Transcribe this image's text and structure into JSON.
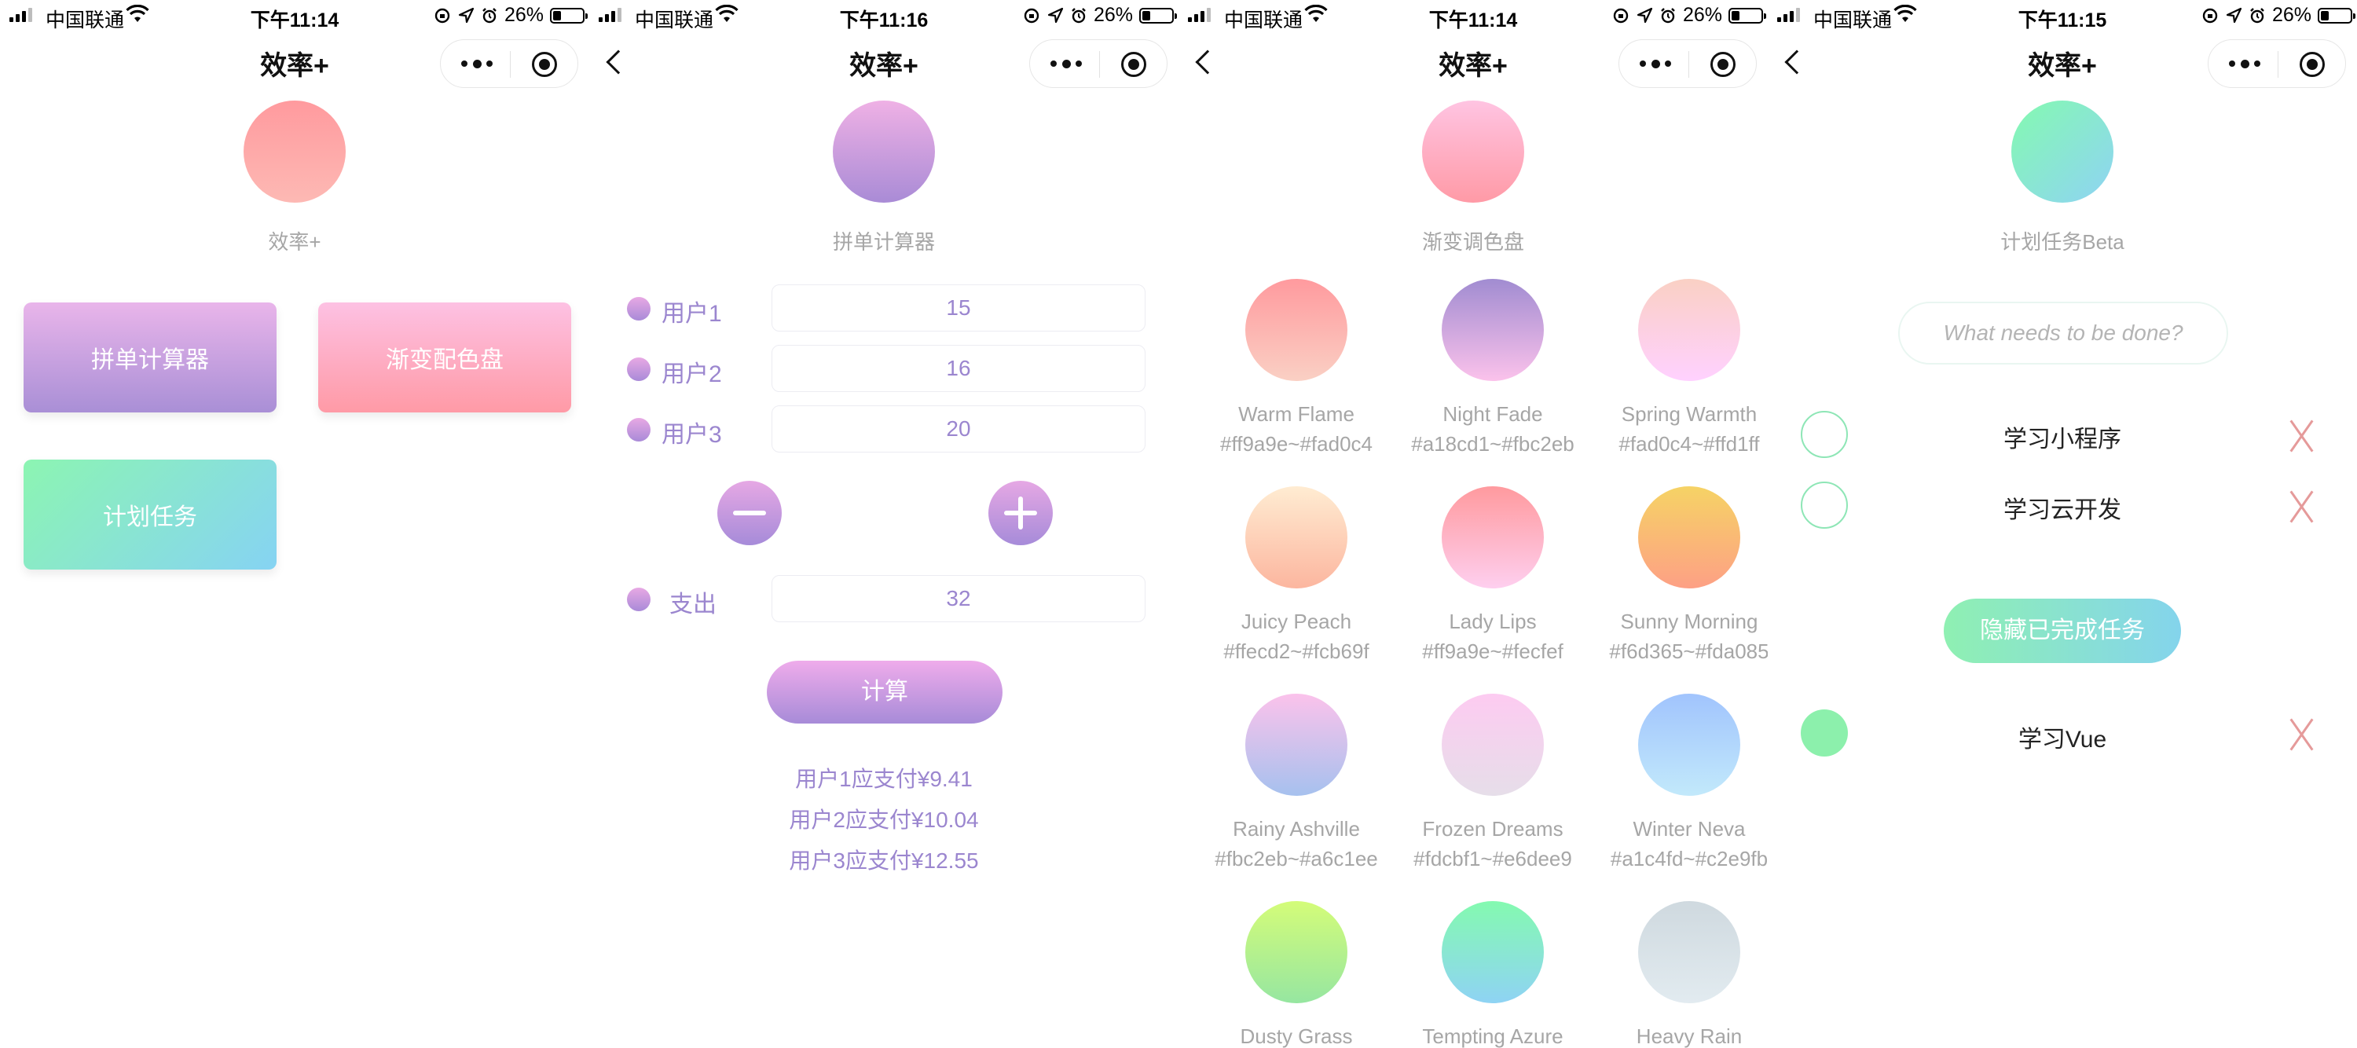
{
  "statusbar": {
    "carrier": "中国联通",
    "battery": "26%",
    "battery_level": 0.26,
    "icons": [
      "signal-icon",
      "wifi-icon",
      "lock-rotation-icon",
      "location-arrow-icon",
      "alarm-icon",
      "battery-icon"
    ]
  },
  "capsule": {
    "icons": [
      "more-dots-icon",
      "close-target-icon"
    ]
  },
  "screens": {
    "home": {
      "time": "下午11:14",
      "title": "效率+",
      "header_label": "效率+",
      "tiles": [
        {
          "label": "拼单计算器",
          "gradient": [
            "#e9b5ea",
            "#a98fd6"
          ]
        },
        {
          "label": "渐变配色盘",
          "gradient": [
            "#fdc1e3",
            "#ff9aa6"
          ]
        },
        {
          "label": "计划任务",
          "gradient": [
            "#8cf5b2",
            "#86d3f3"
          ]
        }
      ]
    },
    "split": {
      "time": "下午11:16",
      "title": "效率+",
      "header_label": "拼单计算器",
      "rows": [
        {
          "label": "用户1",
          "value": "15"
        },
        {
          "label": "用户2",
          "value": "16"
        },
        {
          "label": "用户3",
          "value": "20"
        }
      ],
      "expense": {
        "label": "支出",
        "value": "32"
      },
      "calc_label": "计算",
      "results": [
        "用户1应支付¥9.41",
        "用户2应支付¥10.04",
        "用户3应支付¥12.55"
      ]
    },
    "palette": {
      "time": "下午11:14",
      "title": "效率+",
      "header_label": "渐变调色盘",
      "swatches": [
        {
          "name": "Warm Flame",
          "codes": "#ff9a9e~#fad0c4",
          "from": "#ff9a9e",
          "to": "#fad0c4"
        },
        {
          "name": "Night Fade",
          "codes": "#a18cd1~#fbc2eb",
          "from": "#a18cd1",
          "to": "#fbc2eb"
        },
        {
          "name": "Spring Warmth",
          "codes": "#fad0c4~#ffd1ff",
          "from": "#fad0c4",
          "to": "#ffd1ff"
        },
        {
          "name": "Juicy Peach",
          "codes": "#ffecd2~#fcb69f",
          "from": "#ffecd2",
          "to": "#fcb69f"
        },
        {
          "name": "Lady Lips",
          "codes": "#ff9a9e~#fecfef",
          "from": "#ff9a9e",
          "to": "#fecfef"
        },
        {
          "name": "Sunny Morning",
          "codes": "#f6d365~#fda085",
          "from": "#f6d365",
          "to": "#fda085"
        },
        {
          "name": "Rainy Ashville",
          "codes": "#fbc2eb~#a6c1ee",
          "from": "#fbc2eb",
          "to": "#a6c1ee"
        },
        {
          "name": "Frozen Dreams",
          "codes": "#fdcbf1~#e6dee9",
          "from": "#fdcbf1",
          "to": "#e6dee9"
        },
        {
          "name": "Winter Neva",
          "codes": "#a1c4fd~#c2e9fb",
          "from": "#a1c4fd",
          "to": "#c2e9fb"
        },
        {
          "name": "Dusty Grass",
          "codes": "",
          "from": "#d4fc79",
          "to": "#96e6a1"
        },
        {
          "name": "Tempting Azure",
          "codes": "",
          "from": "#84fab0",
          "to": "#8fd3f4"
        },
        {
          "name": "Heavy Rain",
          "codes": "",
          "from": "#cfd9df",
          "to": "#e2ebf0"
        }
      ]
    },
    "todo": {
      "time": "下午11:15",
      "title": "效率+",
      "header_label": "计划任务Beta",
      "input_placeholder": "What needs to be done?",
      "tasks": [
        {
          "text": "学习小程序",
          "done": false
        },
        {
          "text": "学习云开发",
          "done": false
        }
      ],
      "hide_button": "隐藏已完成任务",
      "completed": [
        {
          "text": "学习Vue",
          "done": true
        }
      ]
    }
  }
}
